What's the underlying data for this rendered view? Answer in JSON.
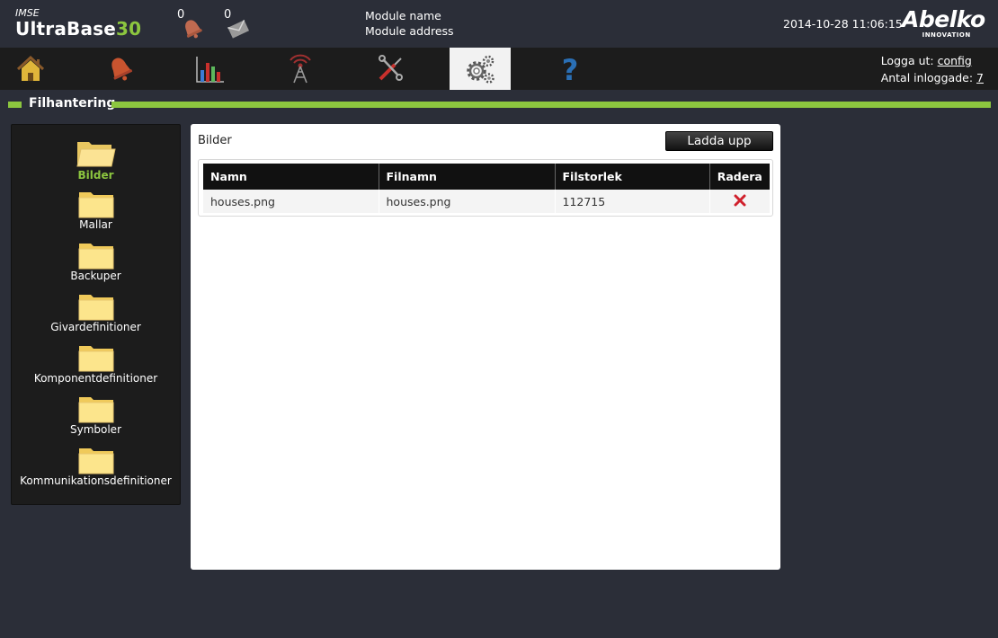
{
  "header": {
    "brand_small": "IMSE",
    "brand_main": "UltraBase",
    "brand_num": "30",
    "alarm_count": "0",
    "message_count": "0",
    "module_name": "Module name",
    "module_address": "Module address",
    "datetime": "2014-10-28 11:06:15",
    "logo_name": "Abelko",
    "logo_sub": "INNOVATION"
  },
  "nav": {
    "items": [
      {
        "icon": "home-icon",
        "active": false
      },
      {
        "icon": "alarm-bell-icon",
        "active": false
      },
      {
        "icon": "bar-chart-icon",
        "active": false
      },
      {
        "icon": "antenna-icon",
        "active": false
      },
      {
        "icon": "tools-icon",
        "active": false
      },
      {
        "icon": "settings-gears-icon",
        "active": true
      },
      {
        "icon": "help-icon",
        "active": false
      }
    ],
    "logout_label": "Logga ut:",
    "logout_user": "config",
    "logged_in_label": "Antal inloggade:",
    "logged_in_count": "7"
  },
  "section": {
    "title": "Filhantering"
  },
  "folders": [
    {
      "label": "Bilder",
      "active": true
    },
    {
      "label": "Mallar",
      "active": false
    },
    {
      "label": "Backuper",
      "active": false
    },
    {
      "label": "Givardefinitioner",
      "active": false
    },
    {
      "label": "Komponentdefinitioner",
      "active": false
    },
    {
      "label": "Symboler",
      "active": false
    },
    {
      "label": "Kommunikationsdefinitioner",
      "active": false
    }
  ],
  "content": {
    "title": "Bilder",
    "upload_label": "Ladda upp",
    "columns": [
      "Namn",
      "Filnamn",
      "Filstorlek",
      "Radera"
    ],
    "rows": [
      {
        "name": "houses.png",
        "filename": "houses.png",
        "size": "112715"
      }
    ]
  },
  "colors": {
    "accent": "#8cc63f",
    "background": "#2b2e38",
    "navbar": "#1c1c1c",
    "delete": "#d0202c"
  }
}
